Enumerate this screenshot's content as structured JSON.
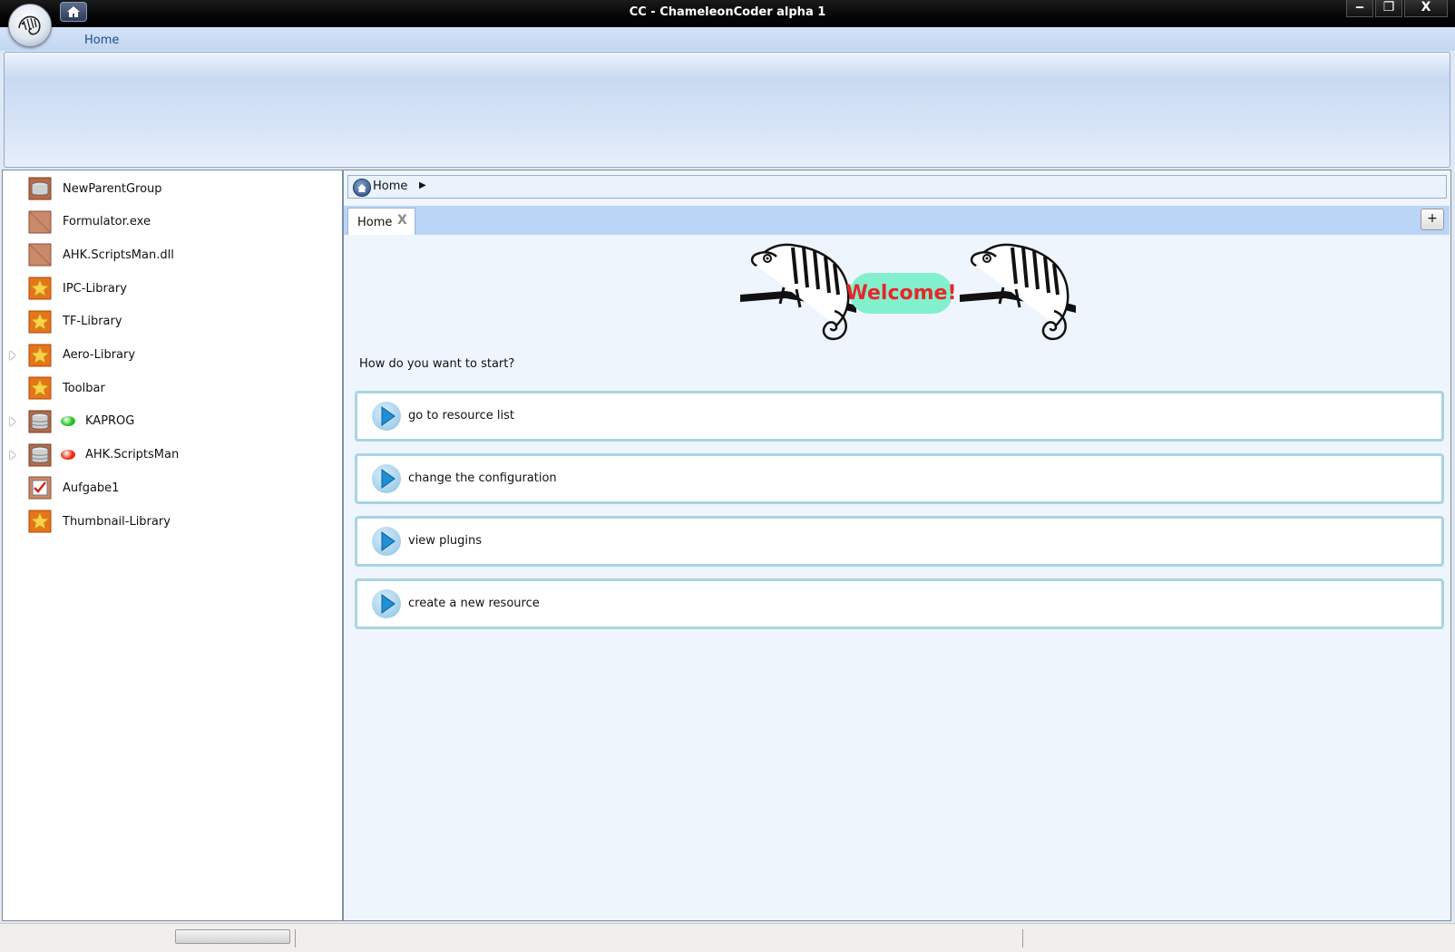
{
  "window": {
    "title": "CC - ChameleonCoder alpha 1",
    "minimize_glyph": "‒",
    "maximize_glyph": "❐",
    "close_glyph": "X"
  },
  "ribbon": {
    "tabs": [
      {
        "label": "Home"
      }
    ]
  },
  "tree": {
    "items": [
      {
        "label": "NewParentGroup",
        "icon": "group-icon",
        "expandable": false,
        "status": null
      },
      {
        "label": "Formulator.exe",
        "icon": "file-icon",
        "expandable": false,
        "status": null
      },
      {
        "label": "AHK.ScriptsMan.dll",
        "icon": "file-icon",
        "expandable": false,
        "status": null
      },
      {
        "label": "IPC-Library",
        "icon": "star-icon",
        "expandable": false,
        "status": null
      },
      {
        "label": "TF-Library",
        "icon": "star-icon",
        "expandable": false,
        "status": null
      },
      {
        "label": "Aero-Library",
        "icon": "star-icon",
        "expandable": true,
        "status": null
      },
      {
        "label": "Toolbar",
        "icon": "star-icon",
        "expandable": false,
        "status": null
      },
      {
        "label": "KAPROG",
        "icon": "database-icon",
        "expandable": true,
        "status": "#22c01c"
      },
      {
        "label": "AHK.ScriptsMan",
        "icon": "database-icon",
        "expandable": true,
        "status": "#ee2a0c"
      },
      {
        "label": "Aufgabe1",
        "icon": "task-icon",
        "expandable": false,
        "status": null
      },
      {
        "label": "Thumbnail-Library",
        "icon": "star-icon",
        "expandable": false,
        "status": null
      }
    ]
  },
  "breadcrumb": {
    "home_label": "Home",
    "arrow": "▶"
  },
  "tabs": {
    "active_label": "Home",
    "close_glyph": "X",
    "add_glyph": "+"
  },
  "welcome": {
    "text": "Welcome!",
    "question": "How do you want to start?",
    "actions": [
      {
        "label": "go to resource list"
      },
      {
        "label": "change the configuration"
      },
      {
        "label": "view plugins"
      },
      {
        "label": "create a new resource"
      }
    ]
  },
  "colors": {
    "accent": "#1d4c8f",
    "welcome_bubble": "#82f0cc",
    "welcome_text": "#e8262a"
  }
}
